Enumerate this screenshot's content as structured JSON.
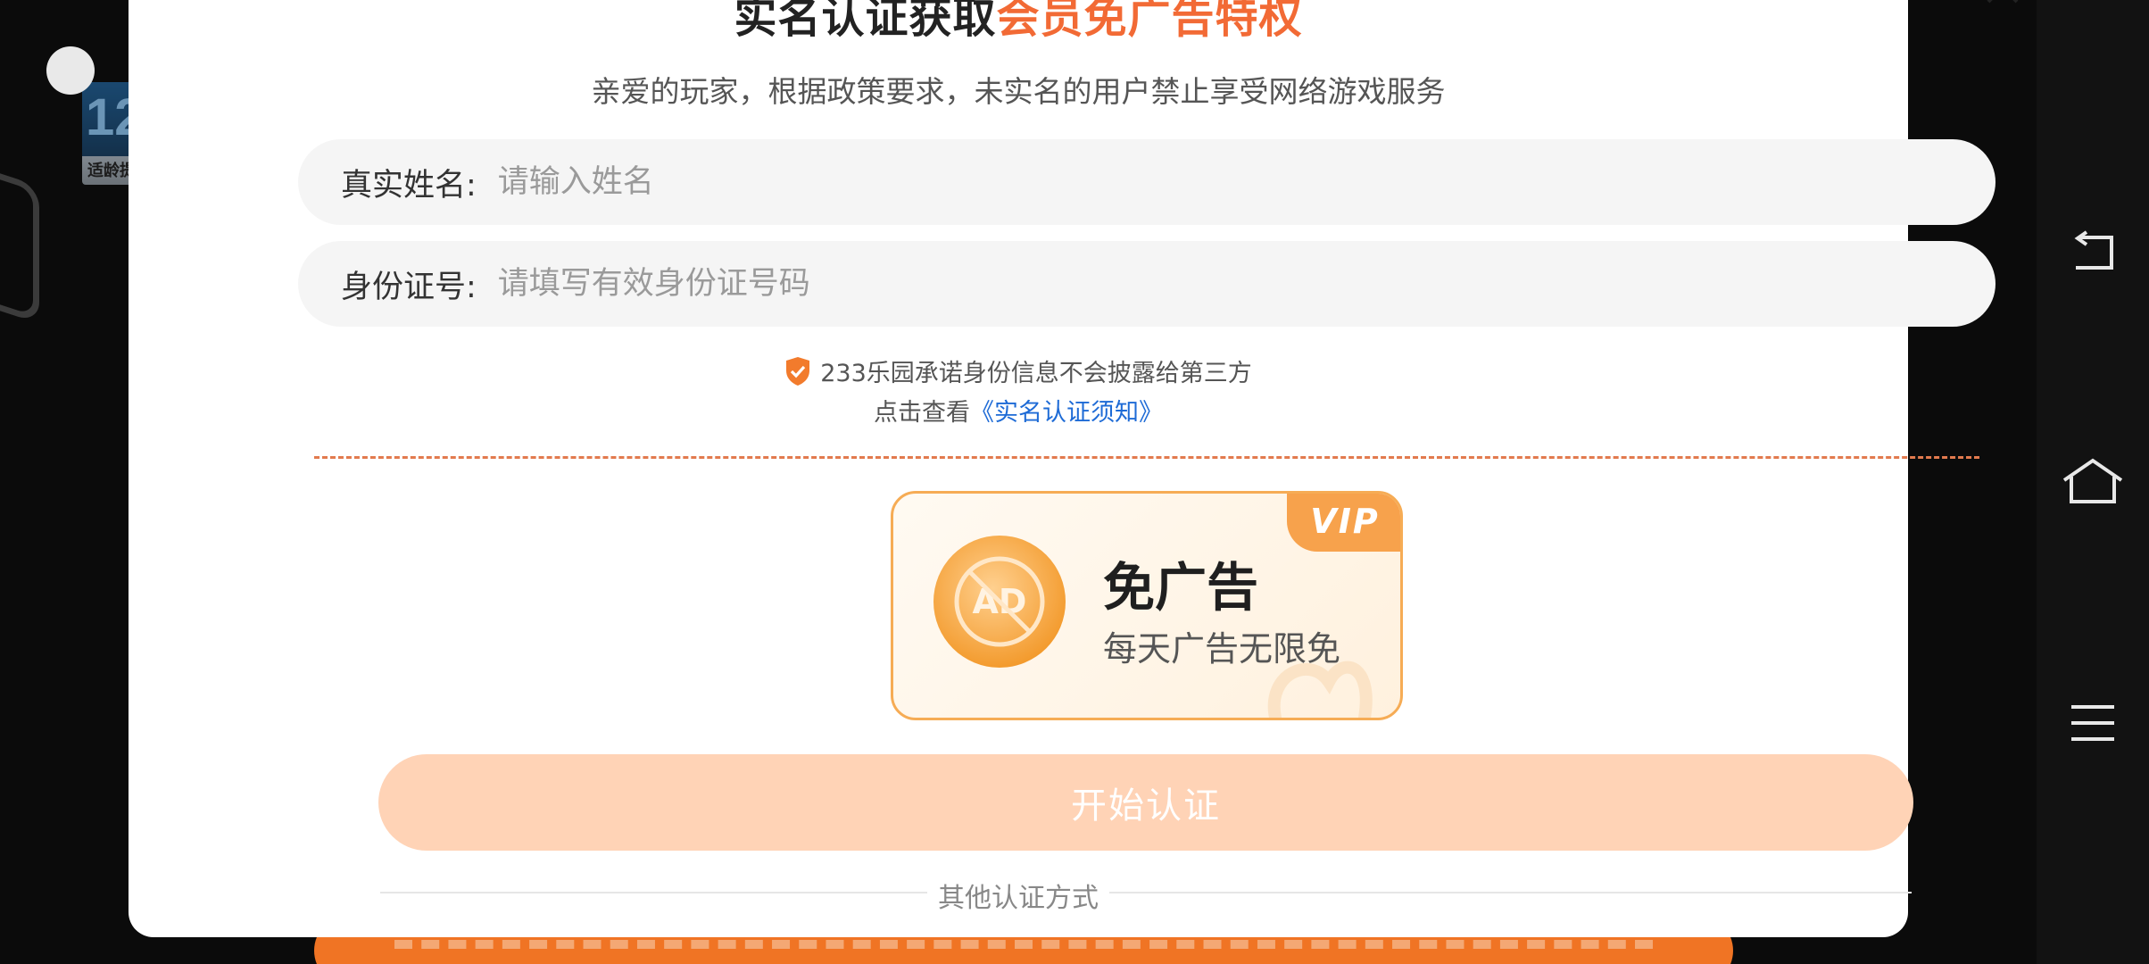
{
  "background": {
    "thumbnail_number": "12",
    "thumbnail_caption": "适龄提"
  },
  "dialog": {
    "title_prefix": "实名认证获取",
    "title_highlight": "会员免广告特权",
    "subtitle": "亲爱的玩家，根据政策要求，未实名的用户禁止享受网络游戏服务",
    "name_field": {
      "label": "真实姓名:",
      "placeholder": "请输入姓名",
      "value": ""
    },
    "id_field": {
      "label": "身份证号:",
      "placeholder": "请填写有效身份证号码",
      "value": ""
    },
    "privacy_promise": "233乐园承诺身份信息不会披露给第三方",
    "notice_prefix": "点击查看",
    "notice_link": "《实名认证须知》",
    "vip_card": {
      "tag": "VIP",
      "icon_text": "AD",
      "title": "免广告",
      "description": "每天广告无限免"
    },
    "start_button": "开始认证",
    "other_methods": "其他认证方式"
  },
  "icons": {
    "close": "close-icon",
    "shield": "shield-check-icon",
    "ad": "no-ad-icon",
    "back": "back-icon",
    "home": "home-icon",
    "menu": "menu-icon"
  },
  "colors": {
    "accent": "#f26a35",
    "link": "#1e6bd6",
    "vip_gold": "#f7a24c",
    "start_button_disabled": "#ffd3b6",
    "divider": "#e27a4e"
  }
}
